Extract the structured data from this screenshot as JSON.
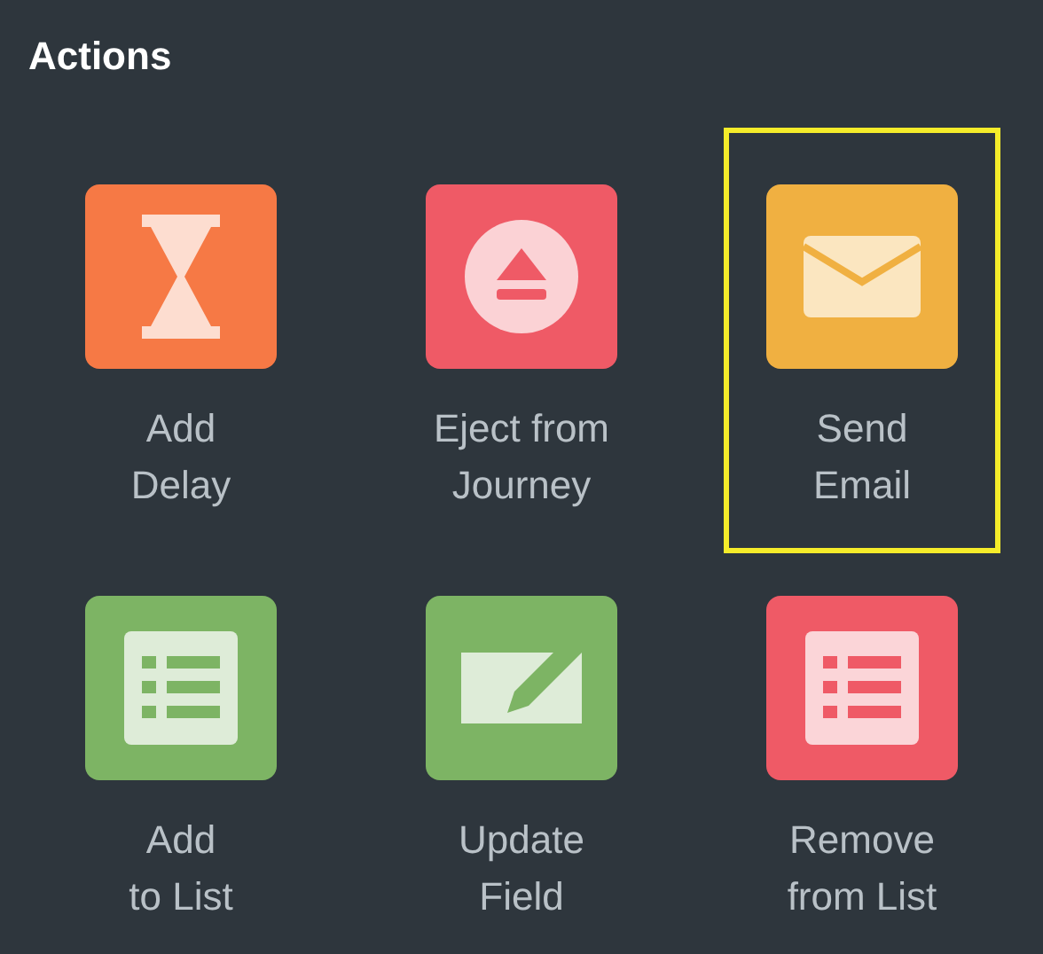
{
  "title": "Actions",
  "actions": [
    {
      "kind": "hourglass",
      "color": "#f67945",
      "lines": [
        "Add",
        "Delay"
      ],
      "selected": false
    },
    {
      "kind": "eject",
      "color": "#ef5a66",
      "lines": [
        "Eject from",
        "Journey"
      ],
      "selected": false
    },
    {
      "kind": "envelope",
      "color": "#f0b041",
      "lines": [
        "Send",
        "Email"
      ],
      "selected": true
    },
    {
      "kind": "list",
      "color": "#7db464",
      "lines": [
        "Add",
        "to List"
      ],
      "selected": false
    },
    {
      "kind": "field",
      "color": "#7db464",
      "lines": [
        "Update",
        "Field"
      ],
      "selected": false
    },
    {
      "kind": "list",
      "color": "#ef5a66",
      "lines": [
        "Remove",
        "from List"
      ],
      "selected": false
    }
  ]
}
